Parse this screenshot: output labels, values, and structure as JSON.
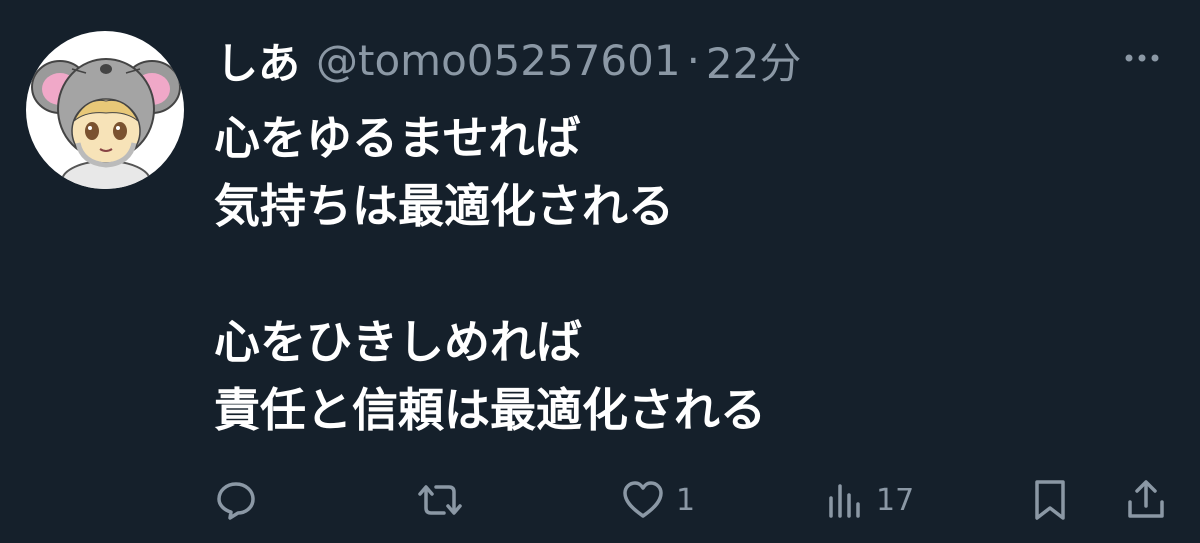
{
  "tweet": {
    "display_name": "しあ",
    "handle": "@tomo05257601",
    "separator": "·",
    "time": "22分",
    "lines": [
      "心をゆるませれば",
      "気持ちは最適化される",
      "",
      "心をひきしめれば",
      "責任と信頼は最適化される"
    ]
  },
  "actions": {
    "reply_icon": "reply-icon",
    "retweet_icon": "retweet-icon",
    "like_icon": "heart-icon",
    "like_count": "1",
    "views_icon": "views-icon",
    "views_count": "17",
    "bookmark_icon": "bookmark-icon",
    "share_icon": "share-icon"
  },
  "colors": {
    "background": "#15202b",
    "text_primary": "#ffffff",
    "text_secondary": "#8b98a5"
  }
}
